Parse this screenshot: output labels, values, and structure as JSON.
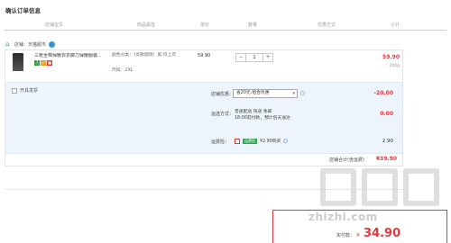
{
  "page_title": "确认订单信息",
  "columns": [
    "店铺宝贝",
    "商品属性",
    "单价",
    "数量",
    "优惠方式",
    "小计"
  ],
  "shop": {
    "label": "店铺：天猫超市"
  },
  "item": {
    "title": "三枪全棉保暖衣衣脚力保暖服装...",
    "spec": "颜色分类：（女款圆领）黑-仅上衣",
    "size": "尺码：2XL",
    "unit_price": "59.90",
    "quantity": "1",
    "qty_minus": "−",
    "qty_plus": "+",
    "subtotal": "59.90",
    "weight": "200g"
  },
  "invoice": {
    "label": "开具发票"
  },
  "promo": {
    "label": "店铺优惠：",
    "selected": "省20元:组合优惠",
    "amount": "-20.00"
  },
  "shipping": {
    "label": "运送方式：",
    "line1": "普通配送 快递 免邮",
    "line2": "18:00前付款，预计后天送达",
    "fee": "0.00"
  },
  "insurance": {
    "label": "运费险：",
    "badge": "运费险",
    "text": "¥2.90购买",
    "fee": "2.90"
  },
  "shop_total": {
    "label": "店铺合计(含运费)",
    "value": "¥39.90"
  },
  "payment": {
    "label": "实付款：",
    "currency": "¥",
    "amount": "34.90"
  },
  "watermark": {
    "text": "zhizhi.com"
  },
  "colors": {
    "accent": "#e4393c",
    "promo_bg": "#eef4fb",
    "header_line": "#b9d1e5"
  }
}
